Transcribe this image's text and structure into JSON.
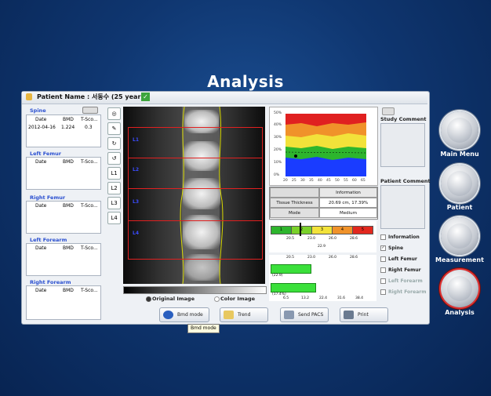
{
  "page_title": "Analysis",
  "header": {
    "patient_label": "Patient Name : 서동수 (25 year)"
  },
  "left": {
    "sections": [
      {
        "title": "Spine",
        "cols": [
          "Date",
          "BMD",
          "T-Sco..."
        ],
        "rows": [
          [
            "2012-04-16",
            "1.224",
            "0.3"
          ]
        ]
      },
      {
        "title": "Left Femur",
        "cols": [
          "Date",
          "BMD",
          "T-Sco..."
        ],
        "rows": []
      },
      {
        "title": "Right Femur",
        "cols": [
          "Date",
          "BMD",
          "T-Sco..."
        ],
        "rows": []
      },
      {
        "title": "Left Forearm",
        "cols": [
          "Date",
          "BMD",
          "T-Sco..."
        ],
        "rows": []
      },
      {
        "title": "Right Forearm",
        "cols": [
          "Date",
          "BMD",
          "T-Sco..."
        ],
        "rows": []
      }
    ]
  },
  "tools": [
    "L1",
    "L2",
    "L3",
    "L4"
  ],
  "image": {
    "roi_labels": [
      "L1",
      "L2",
      "L3",
      "L4"
    ],
    "radio_original": "Original Image",
    "radio_color": "Color Image"
  },
  "chart": {
    "y_ticks": [
      "50%",
      "40%",
      "30%",
      "20%",
      "10%",
      "0%"
    ],
    "x_ticks": [
      "20",
      "25",
      "30",
      "35",
      "40",
      "45",
      "50",
      "55",
      "60",
      "65"
    ]
  },
  "info": {
    "header": "Information",
    "row1_label": "Tissue Thickness",
    "row1_value": "20.69 cm, 17.39%",
    "row2_label": "Mode",
    "row2_value": "Medium"
  },
  "scale": {
    "segments": [
      "1",
      "2",
      "3",
      "4",
      "5"
    ],
    "colors": [
      "#2db52d",
      "#7ad12a",
      "#f2e23a",
      "#f0922a",
      "#e2281e"
    ],
    "ticks": [
      "20.5",
      "23.0",
      "26.0",
      "28.6"
    ],
    "value": "22.9"
  },
  "bars": {
    "top_ticks": [
      "20.5",
      "23.0",
      "26.0",
      "28.6"
    ],
    "bar1_label": "(22.9)",
    "bar2_label": "(17.4%)",
    "bottom_ticks": [
      "6.5",
      "13.2",
      "22.4",
      "31.6",
      "38.4"
    ]
  },
  "comments": {
    "study_title": "Study Comment",
    "patient_title": "Patient Comment"
  },
  "checklist": [
    {
      "label": "Information",
      "checked": false,
      "enabled": true
    },
    {
      "label": "Spine",
      "checked": true,
      "enabled": true
    },
    {
      "label": "Left Femur",
      "checked": false,
      "enabled": true
    },
    {
      "label": "Right Femur",
      "checked": false,
      "enabled": true
    },
    {
      "label": "Left Forearm",
      "checked": false,
      "enabled": false
    },
    {
      "label": "Right Forearm",
      "checked": false,
      "enabled": false
    }
  ],
  "buttons": {
    "bmd_mode": "Bmd mode",
    "trend": "Trend",
    "send_pacs": "Send PACS",
    "print": "Print"
  },
  "tooltip": "Bmd mode",
  "nav": [
    {
      "label": "Main Menu"
    },
    {
      "label": "Patient"
    },
    {
      "label": "Measurement"
    },
    {
      "label": "Analysis"
    }
  ]
}
